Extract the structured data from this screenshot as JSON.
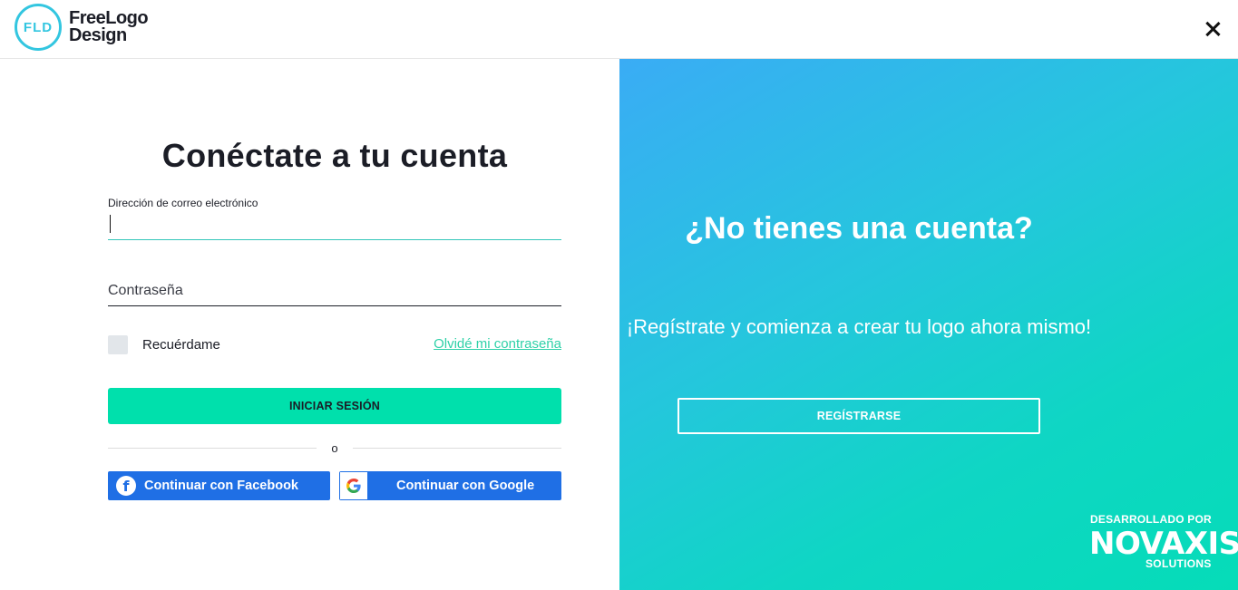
{
  "header": {
    "logo_mark": "FLD",
    "logo_line1": "FreeLogo",
    "logo_line2": "Design",
    "close_icon": "close-icon"
  },
  "login": {
    "title": "Conéctate a tu cuenta",
    "email_label": "Dirección de correo electrónico",
    "email_value": "",
    "password_placeholder": "Contraseña",
    "remember_label": "Recuérdame",
    "forgot_link": "Olvidé mi contraseña",
    "submit_label": "INICIAR SESIÓN",
    "or_text": "o",
    "facebook_label": "Continuar con Facebook",
    "google_label": "Continuar con Google"
  },
  "signup": {
    "title": "¿No tienes una cuenta?",
    "subtitle": "¡Regístrate y comienza a crear tu logo ahora mismo!",
    "register_label": "REGÍSTRARSE",
    "developed_by": "DESARROLLADO POR",
    "brand_name": "NOVAXIS",
    "brand_sub": "SOLUTIONS"
  },
  "colors": {
    "accent": "#00e0ac",
    "link": "#2fd1a8",
    "social_blue": "#1f6fe5",
    "logo_cyan": "#33c6e0"
  }
}
